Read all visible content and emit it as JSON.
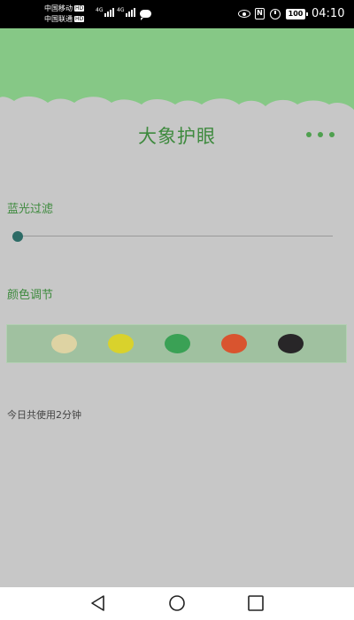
{
  "status_bar": {
    "carrier_1": "中国移动",
    "carrier_2": "中国联通",
    "hd_badge": "HD",
    "network_1": "4G",
    "network_2": "4G",
    "battery": "100",
    "nfc": "N",
    "time": "04:10"
  },
  "header": {
    "title": "大象护眼"
  },
  "blue_light": {
    "label": "蓝光过滤",
    "value_percent": 0
  },
  "color_adjust": {
    "label": "颜色调节",
    "swatches": [
      {
        "color": "#ded3a3"
      },
      {
        "color": "#d9d22c"
      },
      {
        "color": "#3aa155"
      },
      {
        "color": "#d9542f"
      },
      {
        "color": "#282628"
      }
    ]
  },
  "usage": {
    "text": "今日共使用2分钟"
  },
  "colors": {
    "accent_green": "#3e8a3e",
    "header_green": "#86c886",
    "background": "#c7c7c7"
  },
  "nav": {
    "back_icon": "back-triangle-icon",
    "home_icon": "home-circle-icon",
    "recents_icon": "recents-square-icon"
  }
}
